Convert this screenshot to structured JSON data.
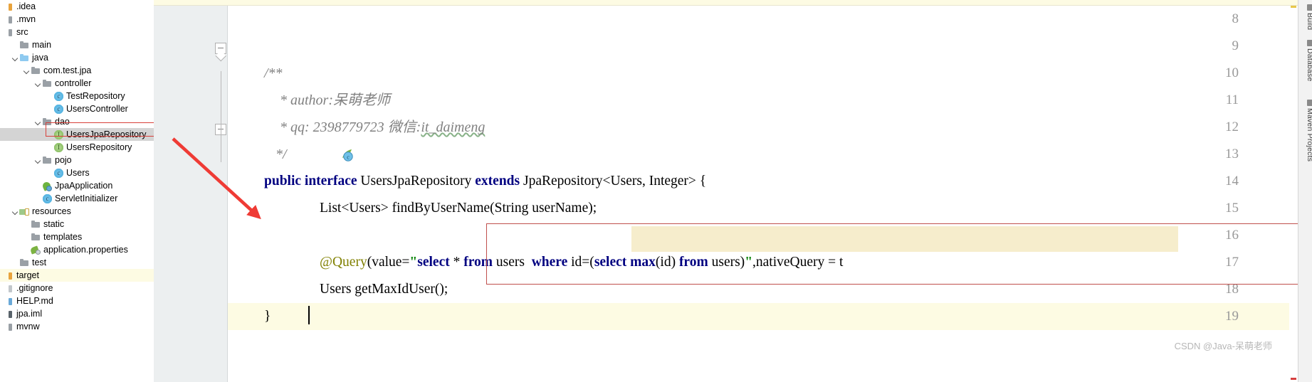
{
  "sidebar": {
    "items": [
      {
        "label": ".idea",
        "icon": "module-stub-orange-icon",
        "depth": 0,
        "kind": "stub-orange",
        "arrow": "none",
        "state": "normal"
      },
      {
        "label": ".mvn",
        "icon": "module-stub-grey-icon",
        "depth": 0,
        "kind": "stub-grey",
        "arrow": "none",
        "state": "normal"
      },
      {
        "label": "src",
        "icon": "module-stub-grey-icon",
        "depth": 0,
        "kind": "stub-grey",
        "arrow": "none",
        "state": "normal"
      },
      {
        "label": "main",
        "icon": "folder-grey-icon",
        "depth": 1,
        "kind": "folder-grey",
        "arrow": "none",
        "state": "normal"
      },
      {
        "label": "java",
        "icon": "folder-blue-icon",
        "depth": 1,
        "kind": "folder-blue",
        "arrow": "down",
        "state": "normal"
      },
      {
        "label": "com.test.jpa",
        "icon": "folder-grey-icon",
        "depth": 2,
        "kind": "folder-grey",
        "arrow": "down",
        "state": "normal"
      },
      {
        "label": "controller",
        "icon": "folder-grey-icon",
        "depth": 3,
        "kind": "folder-grey",
        "arrow": "down",
        "state": "normal"
      },
      {
        "label": "TestRepository",
        "icon": "java-class-icon",
        "depth": 4,
        "kind": "class",
        "arrow": "none",
        "state": "normal"
      },
      {
        "label": "UsersController",
        "icon": "java-class-icon",
        "depth": 4,
        "kind": "class",
        "arrow": "none",
        "state": "normal"
      },
      {
        "label": "dao",
        "icon": "folder-grey-icon",
        "depth": 3,
        "kind": "folder-grey",
        "arrow": "down",
        "state": "normal"
      },
      {
        "label": "UsersJpaRepository",
        "icon": "java-interface-icon",
        "depth": 4,
        "kind": "interface",
        "arrow": "none",
        "state": "selected"
      },
      {
        "label": "UsersRepository",
        "icon": "java-interface-icon",
        "depth": 4,
        "kind": "interface",
        "arrow": "none",
        "state": "normal"
      },
      {
        "label": "pojo",
        "icon": "folder-grey-icon",
        "depth": 3,
        "kind": "folder-grey",
        "arrow": "down",
        "state": "normal"
      },
      {
        "label": "Users",
        "icon": "java-class-icon",
        "depth": 4,
        "kind": "class",
        "arrow": "none",
        "state": "normal"
      },
      {
        "label": "JpaApplication",
        "icon": "spring-boot-app-icon",
        "depth": 3,
        "kind": "spring",
        "arrow": "none",
        "state": "normal"
      },
      {
        "label": "ServletInitializer",
        "icon": "java-class-icon",
        "depth": 3,
        "kind": "class",
        "arrow": "none",
        "state": "normal"
      },
      {
        "label": "resources",
        "icon": "resources-folder-icon",
        "depth": 1,
        "kind": "folder-res",
        "arrow": "down",
        "state": "normal"
      },
      {
        "label": "static",
        "icon": "folder-grey-icon",
        "depth": 2,
        "kind": "folder-grey",
        "arrow": "none",
        "state": "normal"
      },
      {
        "label": "templates",
        "icon": "folder-grey-icon",
        "depth": 2,
        "kind": "folder-grey",
        "arrow": "none",
        "state": "normal"
      },
      {
        "label": "application.properties",
        "icon": "properties-file-icon",
        "depth": 2,
        "kind": "props",
        "arrow": "none",
        "state": "normal"
      },
      {
        "label": "test",
        "icon": "folder-grey-icon",
        "depth": 1,
        "kind": "folder-grey",
        "arrow": "none",
        "state": "normal"
      },
      {
        "label": "target",
        "icon": "module-stub-orange-icon",
        "depth": 0,
        "kind": "stub-orange",
        "arrow": "none",
        "state": "target"
      },
      {
        "label": ".gitignore",
        "icon": "file-stub-silver-icon",
        "depth": 0,
        "kind": "stub-silver",
        "arrow": "none",
        "state": "normal"
      },
      {
        "label": "HELP.md",
        "icon": "file-stub-blue-icon",
        "depth": 0,
        "kind": "stub-blue",
        "arrow": "none",
        "state": "normal"
      },
      {
        "label": "jpa.iml",
        "icon": "file-stub-dark-icon",
        "depth": 0,
        "kind": "stub-dark",
        "arrow": "none",
        "state": "normal"
      },
      {
        "label": "mvnw",
        "icon": "file-stub-grey-icon",
        "depth": 0,
        "kind": "stub-grey",
        "arrow": "none",
        "state": "normal"
      }
    ],
    "highlighted_item": "UsersJpaRepository"
  },
  "editor": {
    "line_numbers": [
      "8",
      "9",
      "10",
      "11",
      "12",
      "13",
      "14",
      "15",
      "16",
      "17",
      "18",
      "19"
    ],
    "lines": {
      "l9_comment": "/**",
      "l10_comment": "* author:呆萌老师",
      "l11_comment_a": "* qq: 2398779723 微信:",
      "l11_comment_b": "it_daimeng",
      "l13_kw1": "public interface",
      "l13_name": " UsersJpaRepository ",
      "l13_kw2": "extends",
      "l13_tail": " JpaRepository<Users, Integer> {",
      "l14_text": "List<Users> findByUserName(String userName);",
      "l16_annotation": "@Query",
      "l16_paren_open": "(value=",
      "l16_quote_open": "\"",
      "l16_sql_select": "select",
      "l16_sql_star": " * ",
      "l16_sql_from": "from",
      "l16_sql_users": " users  ",
      "l16_sql_where": "where",
      "l16_sql_idcond": " id=(",
      "l16_sql_select2": "select",
      "l16_sql_max": " max",
      "l16_sql_idparen": "(id) ",
      "l16_sql_from2": "from",
      "l16_sql_users2": " users)",
      "l16_quote_close": "\"",
      "l16_tail": ",nativeQuery = t",
      "l17_text": "Users getMaxIdUser();",
      "l18_text": "}"
    }
  },
  "right_tool_strip": {
    "tabs": [
      {
        "label": "Build"
      },
      {
        "label": "Database"
      },
      {
        "label": "Maven Projects"
      }
    ]
  },
  "watermark": {
    "text": "CSDN @Java-呆萌老师"
  },
  "colors": {
    "selection_grey": "#d4d4d4",
    "annotation_red": "#d8403a",
    "arrow_red": "#ef3b35",
    "sql_highlight": "#f6edcc",
    "gutter_bg": "#eceff0",
    "keyword_navy": "#000080",
    "annotation_olive": "#808000",
    "string_green": "#008000",
    "comment_grey": "#808080",
    "target_row_yellow": "#fdfbe3"
  }
}
